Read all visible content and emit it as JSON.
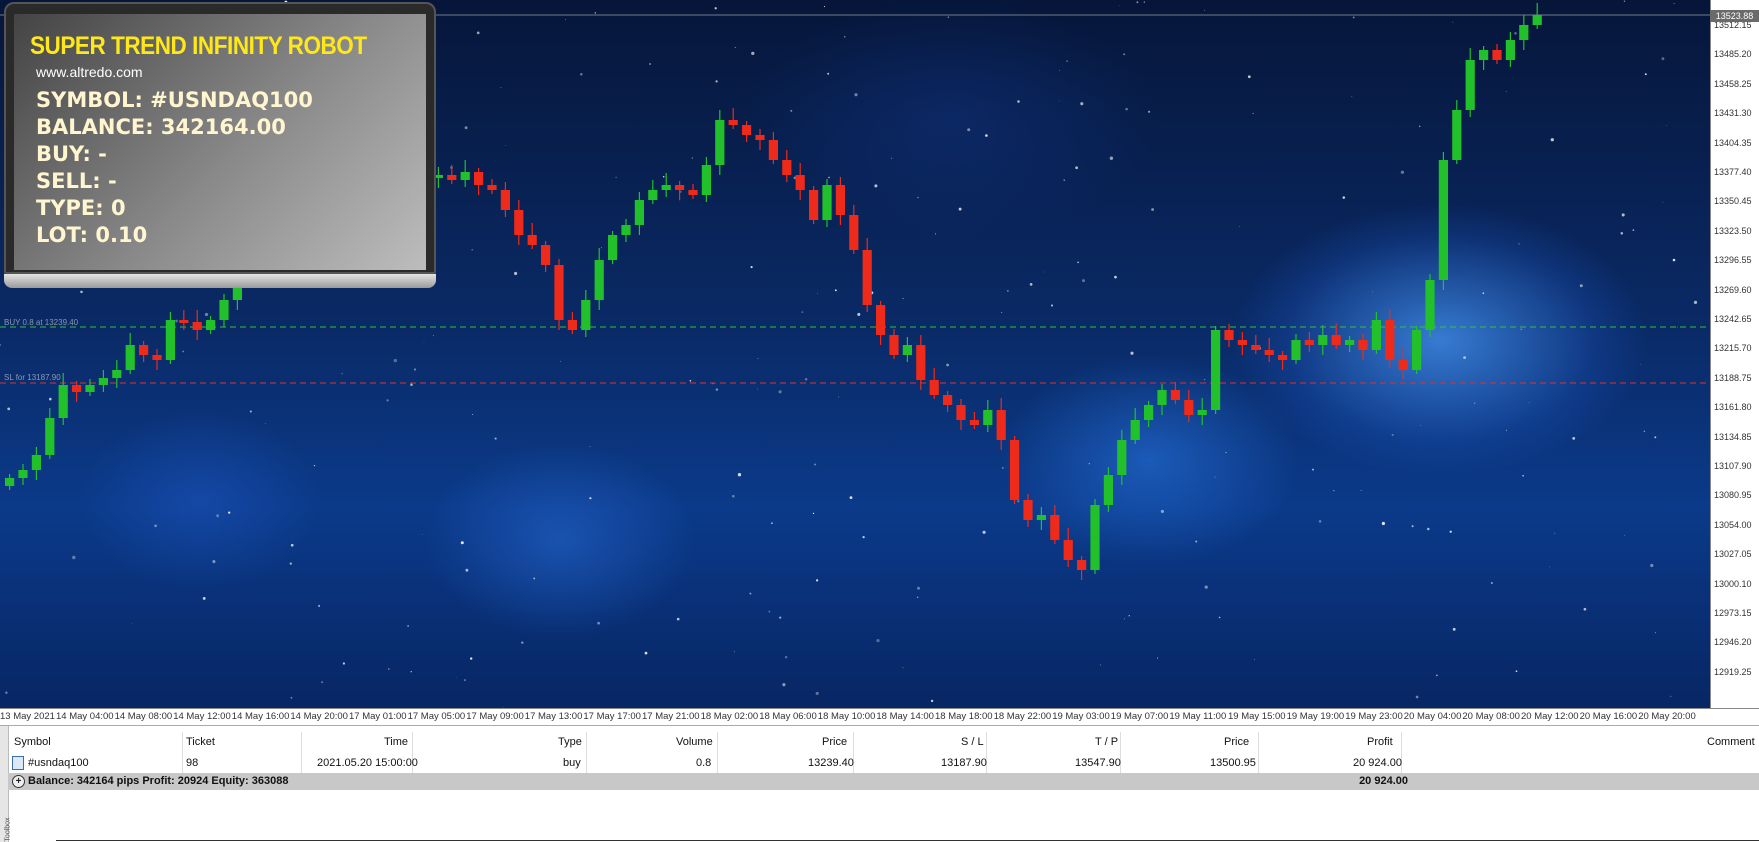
{
  "panel": {
    "title": "SUPER TREND INFINITY ROBOT",
    "url": "www.altredo.com",
    "symbol": "SYMBOL: #USNDAQ100",
    "balance": "BALANCE: 342164.00",
    "buy": "BUY: -",
    "sell": "SELL: -",
    "type": "TYPE: 0",
    "lot": "LOT: 0.10"
  },
  "chart": {
    "current_price": "13523.88",
    "price_labels": [
      "13512.15",
      "13485.20",
      "13458.25",
      "13431.30",
      "13404.35",
      "13377.40",
      "13350.45",
      "13323.50",
      "13296.55",
      "13269.60",
      "13242.65",
      "13215.70",
      "13188.75",
      "13161.80",
      "13134.85",
      "13107.90",
      "13080.95",
      "13054.00",
      "13027.05",
      "13000.10",
      "12973.15",
      "12946.20",
      "12919.25"
    ],
    "time_labels": [
      "13 May 2021",
      "14 May 04:00",
      "14 May 08:00",
      "14 May 12:00",
      "14 May 16:00",
      "14 May 20:00",
      "17 May 01:00",
      "17 May 05:00",
      "17 May 09:00",
      "17 May 13:00",
      "17 May 17:00",
      "17 May 21:00",
      "18 May 02:00",
      "18 May 06:00",
      "18 May 10:00",
      "18 May 14:00",
      "18 May 18:00",
      "18 May 22:00",
      "19 May 03:00",
      "19 May 07:00",
      "19 May 11:00",
      "19 May 15:00",
      "19 May 19:00",
      "19 May 23:00",
      "20 May 04:00",
      "20 May 08:00",
      "20 May 12:00",
      "20 May 16:00",
      "20 May 20:00"
    ],
    "buy_level_label": "BUY 0.8 at 13239.40",
    "sl_level_label": "SL for 13187.90",
    "up_color": "#22c02a",
    "down_color": "#ee2a1a"
  },
  "terminal": {
    "headers": {
      "symbol": "Symbol",
      "ticket": "Ticket",
      "time": "Time",
      "type": "Type",
      "volume": "Volume",
      "price": "Price",
      "sl": "S / L",
      "tp": "T / P",
      "price2": "Price",
      "profit": "Profit",
      "comment": "Comment"
    },
    "row": {
      "symbol": "#usndaq100",
      "ticket": "98",
      "time": "2021.05.20 15:00:00",
      "type": "buy",
      "volume": "0.8",
      "price": "13239.40",
      "sl": "13187.90",
      "tp": "13547.90",
      "price2": "13500.95",
      "profit": "20 924.00"
    },
    "summary": "Balance: 342164 pips   Profit: 20924   Equity: 363088",
    "summary_total": "20 924.00",
    "side_label": "Toolbox"
  }
}
